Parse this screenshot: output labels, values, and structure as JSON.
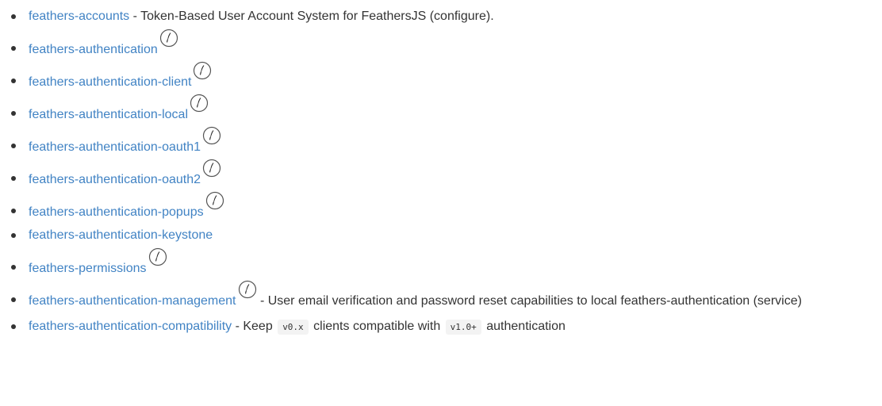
{
  "items": [
    {
      "link": "feathers-accounts",
      "sep": " - ",
      "desc": "Token-Based User Account System for FeathersJS (configure).",
      "icon": null
    },
    {
      "link": "feathers-authentication",
      "icon": "feather-icon"
    },
    {
      "link": "feathers-authentication-client",
      "icon": "feather-icon"
    },
    {
      "link": "feathers-authentication-local",
      "icon": "feather-icon"
    },
    {
      "link": "feathers-authentication-oauth1",
      "icon": "feather-icon"
    },
    {
      "link": "feathers-authentication-oauth2",
      "icon": "feather-icon"
    },
    {
      "link": "feathers-authentication-popups",
      "icon": "feather-icon"
    },
    {
      "link": "feathers-authentication-keystone",
      "icon": null
    },
    {
      "link": "feathers-permissions",
      "icon": "feather-icon"
    },
    {
      "link": "feathers-authentication-management",
      "icon": "feather-icon",
      "sep": " - ",
      "desc": "User email verification and password reset capabilities to local feathers-authentication (service)"
    },
    {
      "link": "feathers-authentication-compatibility",
      "sep": " - ",
      "desc_parts": {
        "pre": "Keep",
        "code1": "v0.x",
        "mid": "clients compatible with",
        "code2": "v1.0+",
        "post": "authentication"
      },
      "icon": null
    }
  ]
}
